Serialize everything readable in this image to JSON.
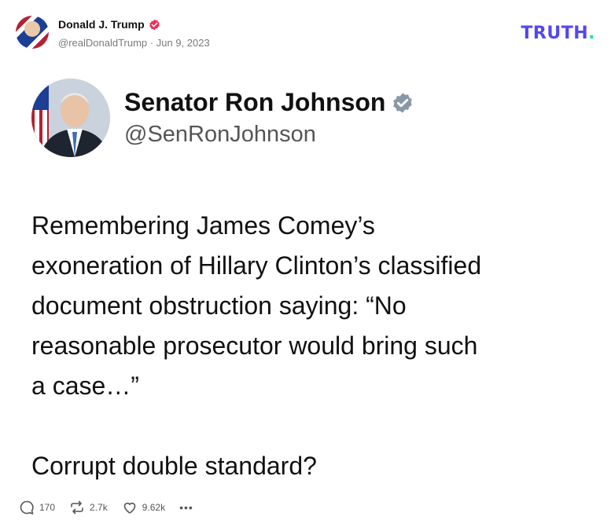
{
  "post": {
    "author_name": "Donald J. Trump",
    "author_handle": "@realDonaldTrump",
    "separator": "·",
    "date": "Jun 9, 2023",
    "brand": "TRUTH",
    "brand_dot": "."
  },
  "quoted": {
    "name": "Senator Ron Johnson",
    "handle": "@SenRonJohnson",
    "text_lines": [
      "Remembering James Comey’s",
      "exoneration of Hillary Clinton’s classified",
      "document obstruction saying: “No",
      "reasonable prosecutor would bring such",
      "a case…”"
    ],
    "text_after": "Corrupt double standard?"
  },
  "actions": {
    "replies": "170",
    "retruths": "2.7k",
    "likes": "9.62k",
    "more": "•••"
  },
  "colors": {
    "brand": "#5448ee",
    "brand_dot": "#19e3b1",
    "verified_red": "#e8345a",
    "verified_gray": "#8a97a6"
  }
}
